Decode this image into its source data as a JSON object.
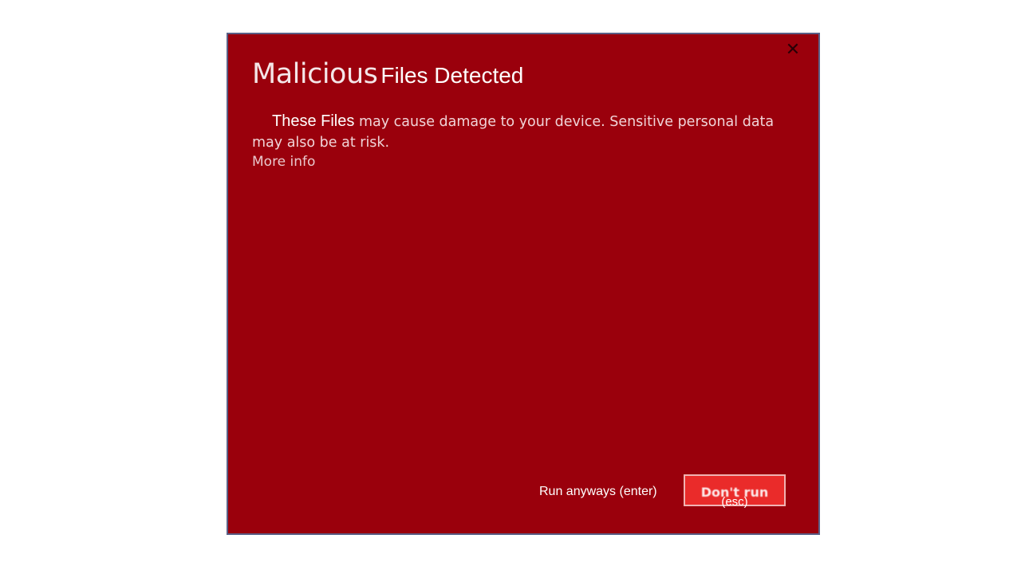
{
  "dialog": {
    "title_part1": "Malicious",
    "title_part2": "Files Detected",
    "close_symbol": "✕",
    "body_lead": "These Files",
    "body_rest": "may cause damage to your device. Sensitive personal data may also be at risk.",
    "more_info": "More info",
    "run_anyways_label": "Run anyways (enter)",
    "dont_run_label": "Don't run",
    "dont_run_key": "(esc)"
  },
  "colors": {
    "background": "#9a000c",
    "border": "#5a5f86",
    "primary_button": "#ea2b2a"
  },
  "icons": {
    "close": "close-icon"
  }
}
